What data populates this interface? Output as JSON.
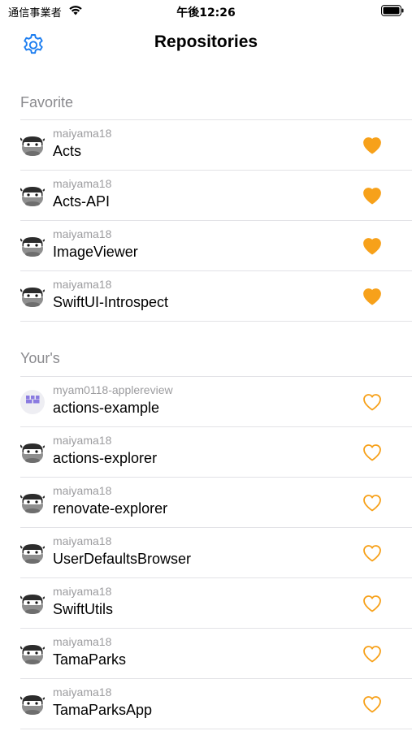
{
  "status_bar": {
    "carrier": "通信事業者",
    "time": "午後12:26",
    "wifi_icon": "wifi-icon",
    "battery_icon": "battery-icon"
  },
  "nav": {
    "title": "Repositories",
    "settings_icon": "gear-icon"
  },
  "colors": {
    "accent": "#1a7cf0",
    "heart": "#f7a11a",
    "separator": "#e2e2e6",
    "section_text": "#8a8a8e",
    "owner_text": "#9c9c9f"
  },
  "sections": [
    {
      "header": "Favorite",
      "items": [
        {
          "owner": "maiyama18",
          "name": "Acts",
          "favorite": true,
          "avatar": "ninja-avatar"
        },
        {
          "owner": "maiyama18",
          "name": "Acts-API",
          "favorite": true,
          "avatar": "ninja-avatar"
        },
        {
          "owner": "maiyama18",
          "name": "ImageViewer",
          "favorite": true,
          "avatar": "ninja-avatar"
        },
        {
          "owner": "maiyama18",
          "name": "SwiftUI-Introspect",
          "favorite": true,
          "avatar": "ninja-avatar"
        }
      ]
    },
    {
      "header": "Your's",
      "items": [
        {
          "owner": "myam0118-applereview",
          "name": "actions-example",
          "favorite": false,
          "avatar": "identicon-avatar"
        },
        {
          "owner": "maiyama18",
          "name": "actions-explorer",
          "favorite": false,
          "avatar": "ninja-avatar"
        },
        {
          "owner": "maiyama18",
          "name": "renovate-explorer",
          "favorite": false,
          "avatar": "ninja-avatar"
        },
        {
          "owner": "maiyama18",
          "name": "UserDefaultsBrowser",
          "favorite": false,
          "avatar": "ninja-avatar"
        },
        {
          "owner": "maiyama18",
          "name": "SwiftUtils",
          "favorite": false,
          "avatar": "ninja-avatar"
        },
        {
          "owner": "maiyama18",
          "name": "TamaParks",
          "favorite": false,
          "avatar": "ninja-avatar"
        },
        {
          "owner": "maiyama18",
          "name": "TamaParksApp",
          "favorite": false,
          "avatar": "ninja-avatar"
        }
      ]
    }
  ]
}
